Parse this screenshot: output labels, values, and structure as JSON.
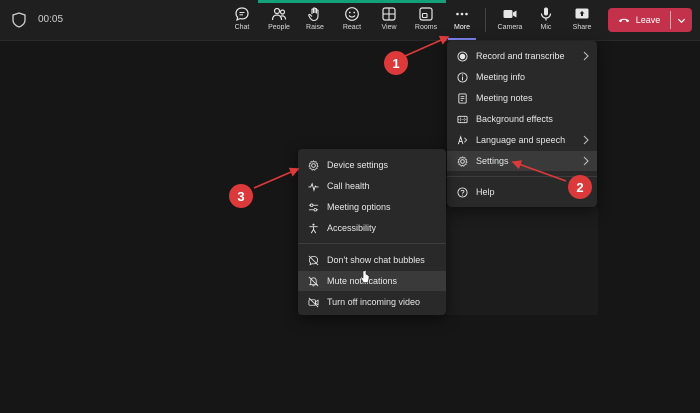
{
  "meeting": {
    "timer": "00:05"
  },
  "toolbar": {
    "chat": "Chat",
    "people": "People",
    "raise": "Raise",
    "react": "React",
    "view": "View",
    "rooms": "Rooms",
    "more": "More",
    "camera": "Camera",
    "mic": "Mic",
    "share": "Share",
    "leave": "Leave"
  },
  "more_menu": {
    "items": [
      {
        "label": "Record and transcribe",
        "icon": "record-icon",
        "submenu": true
      },
      {
        "label": "Meeting info",
        "icon": "info-icon",
        "submenu": false
      },
      {
        "label": "Meeting notes",
        "icon": "notes-icon",
        "submenu": false
      },
      {
        "label": "Background effects",
        "icon": "background-effects-icon",
        "submenu": false
      },
      {
        "label": "Language and speech",
        "icon": "language-icon",
        "submenu": true
      },
      {
        "label": "Settings",
        "icon": "gear-icon",
        "submenu": true
      },
      {
        "label": "Help",
        "icon": "help-icon",
        "submenu": false
      }
    ]
  },
  "settings_menu": {
    "items": [
      {
        "label": "Device settings",
        "icon": "gear-icon"
      },
      {
        "label": "Call health",
        "icon": "pulse-icon"
      },
      {
        "label": "Meeting options",
        "icon": "sliders-icon"
      },
      {
        "label": "Accessibility",
        "icon": "accessibility-icon"
      },
      {
        "label": "Don't show chat bubbles",
        "icon": "chat-off-icon"
      },
      {
        "label": "Mute notifications",
        "icon": "bell-off-icon"
      },
      {
        "label": "Turn off incoming video",
        "icon": "video-off-icon"
      }
    ]
  },
  "annotations": {
    "step1": "1",
    "step2": "2",
    "step3": "3"
  },
  "colors": {
    "leave": "#c4314b",
    "callout": "#dc3a3a",
    "meeting_strip": "#13a17a"
  }
}
